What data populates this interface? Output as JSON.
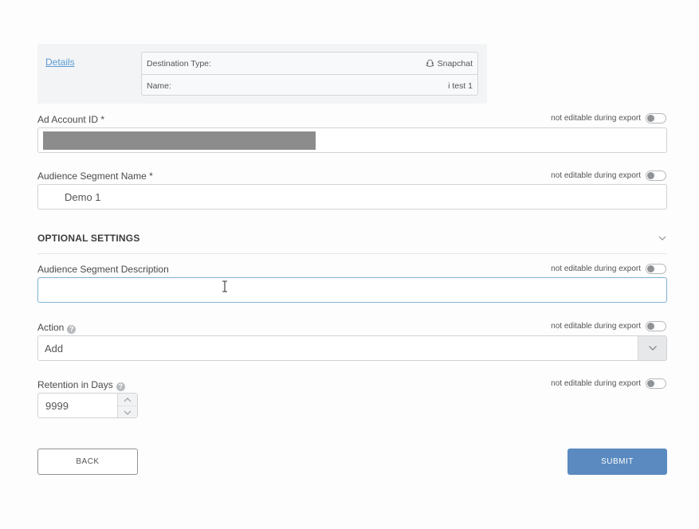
{
  "details": {
    "link_label": "Details",
    "destination_type_label": "Destination Type:",
    "destination_type_value": "Snapchat",
    "destination_type_icon": "snapchat-ghost-icon",
    "name_label": "Name:",
    "name_value": "i test 1"
  },
  "lock_label": "not editable during export",
  "ad_account": {
    "label": "Ad Account ID *",
    "value_redacted": true
  },
  "segment_name": {
    "label": "Audience Segment Name *",
    "value": "Demo 1"
  },
  "optional_settings": {
    "title": "OPTIONAL SETTINGS",
    "icon": "chevron-down-icon"
  },
  "segment_description": {
    "label": "Audience Segment Description",
    "value": ""
  },
  "action": {
    "label": "Action",
    "help_icon": "help-icon",
    "selected": "Add"
  },
  "retention": {
    "label": "Retention in Days",
    "help_icon": "help-icon",
    "value": "9999"
  },
  "buttons": {
    "back": "BACK",
    "submit": "SUBMIT"
  },
  "colors": {
    "link": "#5b9bd5",
    "submit_bg": "#5a8ac0",
    "focus_border": "#7fb2d6"
  }
}
